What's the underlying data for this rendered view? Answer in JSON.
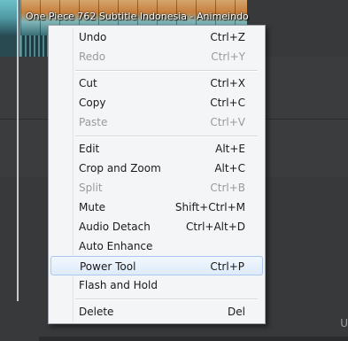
{
  "timeline": {
    "clip_title": "One Piece 762 Subtitle Indonesia - Animeindo",
    "corner_text": "U"
  },
  "menu": {
    "undo": {
      "label": "Undo",
      "shortcut": "Ctrl+Z"
    },
    "redo": {
      "label": "Redo",
      "shortcut": "Ctrl+Y"
    },
    "cut": {
      "label": "Cut",
      "shortcut": "Ctrl+X"
    },
    "copy": {
      "label": "Copy",
      "shortcut": "Ctrl+C"
    },
    "paste": {
      "label": "Paste",
      "shortcut": "Ctrl+V"
    },
    "edit": {
      "label": "Edit",
      "shortcut": "Alt+E"
    },
    "crop": {
      "label": "Crop and Zoom",
      "shortcut": "Alt+C"
    },
    "split": {
      "label": "Split",
      "shortcut": "Ctrl+B"
    },
    "mute": {
      "label": "Mute",
      "shortcut": "Shift+Ctrl+M"
    },
    "audio_detach": {
      "label": "Audio Detach",
      "shortcut": "Ctrl+Alt+D"
    },
    "auto_enhance": {
      "label": "Auto Enhance",
      "shortcut": ""
    },
    "power_tool": {
      "label": "Power Tool",
      "shortcut": "Ctrl+P"
    },
    "flash_hold": {
      "label": "Flash and Hold",
      "shortcut": ""
    },
    "delete": {
      "label": "Delete",
      "shortcut": "Del"
    }
  }
}
